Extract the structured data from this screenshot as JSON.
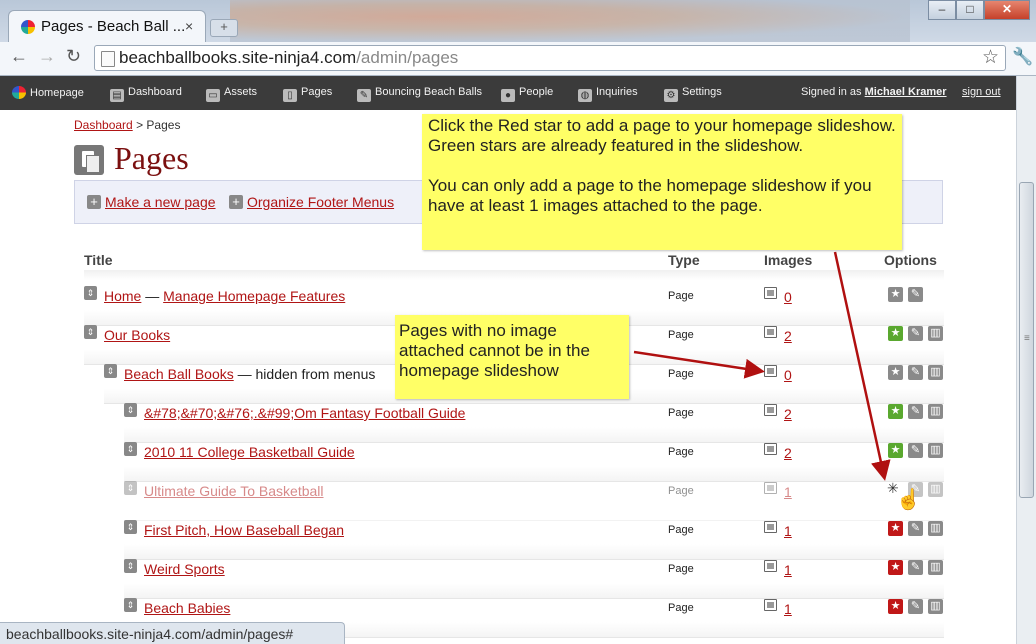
{
  "browser": {
    "tab_title": "Pages - Beach Ball ...",
    "tab_close": "×",
    "new_tab": "+",
    "url_host": "beachballbooks.site-ninja4.com",
    "url_path": "/admin/pages",
    "status_url": "beachballbooks.site-ninja4.com/admin/pages#"
  },
  "admin_nav": {
    "items": [
      "Homepage",
      "Dashboard",
      "Assets",
      "Pages",
      "Bouncing Beach Balls",
      "People",
      "Inquiries",
      "Settings"
    ],
    "signed_in_prefix": "Signed in as",
    "user": "Michael Kramer",
    "sign_out": "sign out"
  },
  "breadcrumb": {
    "root": "Dashboard",
    "sep": ">",
    "current": "Pages"
  },
  "page_title": "Pages",
  "actions": {
    "new_page": "Make a new page",
    "organize_footer": "Organize Footer Menus"
  },
  "table": {
    "headers": {
      "title": "Title",
      "type": "Type",
      "images": "Images",
      "options": "Options"
    },
    "rows": [
      {
        "title": "Home",
        "sep": "—",
        "extra_link": "Manage Homepage Features",
        "type": "Page",
        "images": "0",
        "star": "grey"
      },
      {
        "title": "Our Books",
        "type": "Page",
        "images": "2",
        "star": "green"
      },
      {
        "title": "Beach Ball Books",
        "note": "— hidden from menus",
        "type": "Page",
        "images": "0",
        "star": "grey"
      },
      {
        "title": "&#78;&#70;&#76;.&#99;Om Fantasy Football Guide",
        "type": "Page",
        "images": "2",
        "star": "green"
      },
      {
        "title": "2010 11 College Basketball Guide",
        "type": "Page",
        "images": "2",
        "star": "green"
      },
      {
        "title": "Ultimate Guide To Basketball",
        "type": "Page",
        "images": "1",
        "star": "loading"
      },
      {
        "title": "First Pitch, How Baseball Began",
        "type": "Page",
        "images": "1",
        "star": "red"
      },
      {
        "title": "Weird Sports",
        "type": "Page",
        "images": "1",
        "star": "red"
      },
      {
        "title": "Beach Babies",
        "type": "Page",
        "images": "1",
        "star": "red"
      }
    ]
  },
  "callouts": {
    "main_line1": "Click the Red star to add a page to your homepage slideshow.  Green stars are already featured in the slideshow.",
    "main_line2": "You can only add a page to the homepage slideshow if you have at least 1 images attached to the page.",
    "no_image": "Pages with no image attached cannot be in the homepage slideshow"
  },
  "icons": {
    "star": "★",
    "edit": "✎",
    "delete": "🗑",
    "reorder": "⇕",
    "back": "←",
    "forward": "→",
    "reload": "↻",
    "bookmark": "☆",
    "wrench": "🔧"
  },
  "colors": {
    "link": "#b01515",
    "nav_bg": "#3b3b3b",
    "callout": "#ffff66",
    "star_green": "#5aa82f",
    "star_red": "#c01818",
    "arrow": "#b01010"
  }
}
